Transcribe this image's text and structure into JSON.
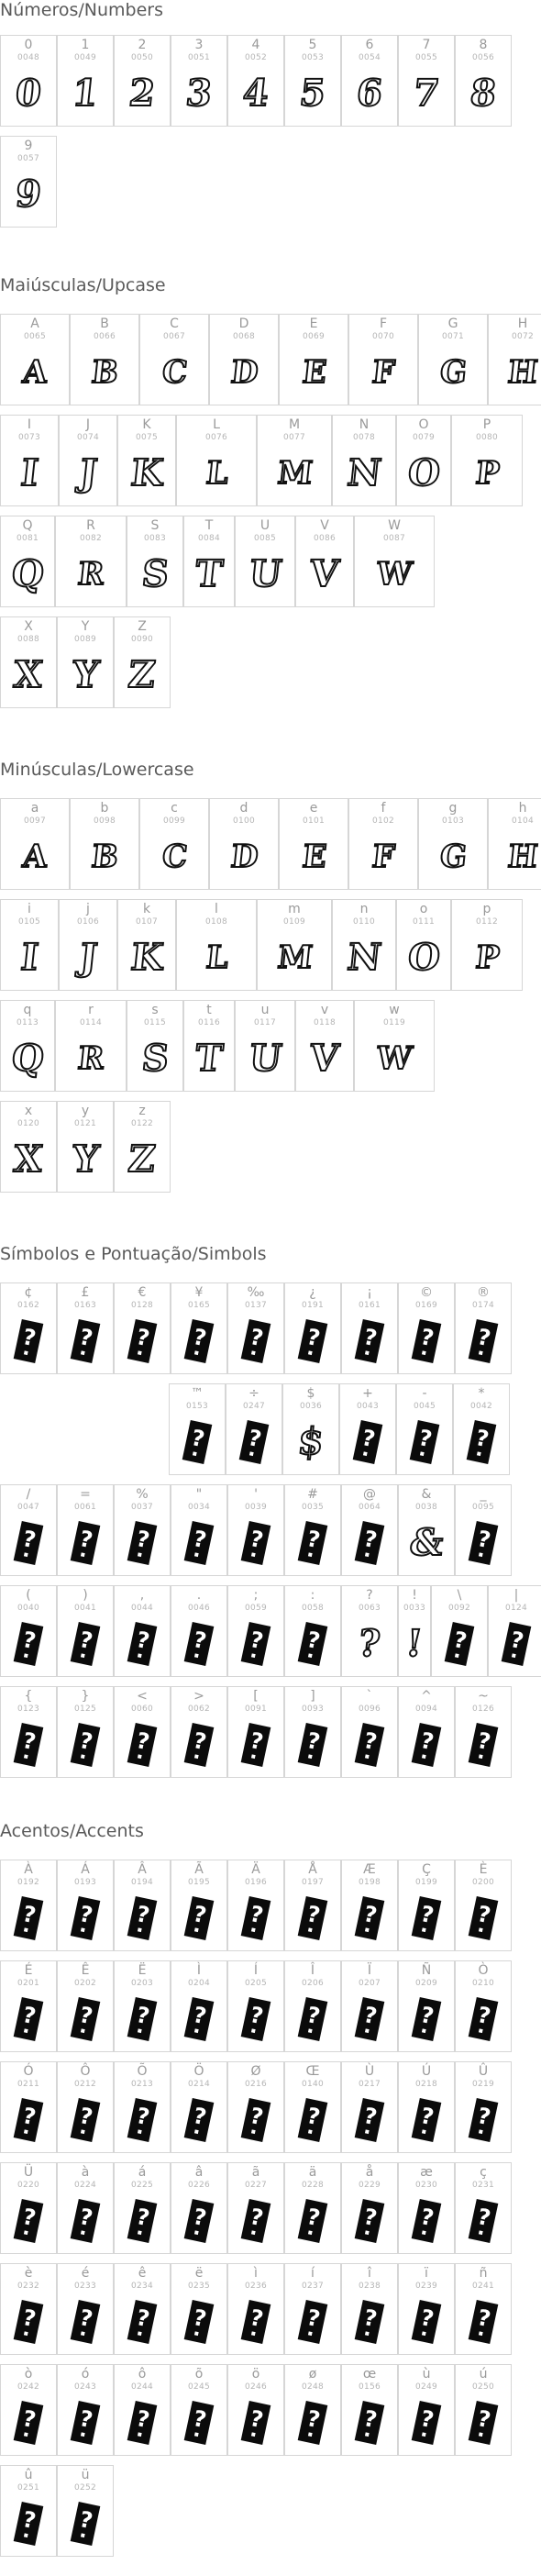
{
  "sections": [
    {
      "id": "numbers",
      "title": "Números/Numbers",
      "cells": [
        {
          "label": "0",
          "code": "0048",
          "glyph": "0"
        },
        {
          "label": "1",
          "code": "0049",
          "glyph": "1"
        },
        {
          "label": "2",
          "code": "0050",
          "glyph": "2"
        },
        {
          "label": "3",
          "code": "0051",
          "glyph": "3"
        },
        {
          "label": "4",
          "code": "0052",
          "glyph": "4"
        },
        {
          "label": "5",
          "code": "0053",
          "glyph": "5"
        },
        {
          "label": "6",
          "code": "0054",
          "glyph": "6"
        },
        {
          "label": "7",
          "code": "0055",
          "glyph": "7"
        },
        {
          "label": "8",
          "code": "0056",
          "glyph": "8"
        },
        {
          "label": "9",
          "code": "0057",
          "glyph": "9"
        }
      ]
    },
    {
      "id": "upper",
      "title": "Maiúsculas/Upcase",
      "cells": [
        {
          "label": "A",
          "code": "0065",
          "glyph": "A"
        },
        {
          "label": "B",
          "code": "0066",
          "glyph": "B"
        },
        {
          "label": "C",
          "code": "0067",
          "glyph": "C"
        },
        {
          "label": "D",
          "code": "0068",
          "glyph": "D"
        },
        {
          "label": "E",
          "code": "0069",
          "glyph": "E"
        },
        {
          "label": "F",
          "code": "0070",
          "glyph": "F"
        },
        {
          "label": "G",
          "code": "0071",
          "glyph": "G"
        },
        {
          "label": "H",
          "code": "0072",
          "glyph": "H"
        },
        {
          "label": "I",
          "code": "0073",
          "glyph": "I"
        },
        {
          "label": "J",
          "code": "0074",
          "glyph": "J"
        },
        {
          "label": "K",
          "code": "0075",
          "glyph": "K"
        },
        {
          "label": "L",
          "code": "0076",
          "glyph": "L"
        },
        {
          "label": "M",
          "code": "0077",
          "glyph": "M"
        },
        {
          "label": "N",
          "code": "0078",
          "glyph": "N"
        },
        {
          "label": "O",
          "code": "0079",
          "glyph": "O"
        },
        {
          "label": "P",
          "code": "0080",
          "glyph": "P"
        },
        {
          "label": "Q",
          "code": "0081",
          "glyph": "Q"
        },
        {
          "label": "R",
          "code": "0082",
          "glyph": "R"
        },
        {
          "label": "S",
          "code": "0083",
          "glyph": "S"
        },
        {
          "label": "T",
          "code": "0084",
          "glyph": "T"
        },
        {
          "label": "U",
          "code": "0085",
          "glyph": "U"
        },
        {
          "label": "V",
          "code": "0086",
          "glyph": "V"
        },
        {
          "label": "W",
          "code": "0087",
          "glyph": "W"
        },
        {
          "label": "X",
          "code": "0088",
          "glyph": "X"
        },
        {
          "label": "Y",
          "code": "0089",
          "glyph": "Y"
        },
        {
          "label": "Z",
          "code": "0090",
          "glyph": "Z"
        }
      ]
    },
    {
      "id": "lower",
      "title": "Minúsculas/Lowercase",
      "cells": [
        {
          "label": "a",
          "code": "0097",
          "glyph": "A"
        },
        {
          "label": "b",
          "code": "0098",
          "glyph": "B"
        },
        {
          "label": "c",
          "code": "0099",
          "glyph": "C"
        },
        {
          "label": "d",
          "code": "0100",
          "glyph": "D"
        },
        {
          "label": "e",
          "code": "0101",
          "glyph": "E"
        },
        {
          "label": "f",
          "code": "0102",
          "glyph": "F"
        },
        {
          "label": "g",
          "code": "0103",
          "glyph": "G"
        },
        {
          "label": "h",
          "code": "0104",
          "glyph": "H"
        },
        {
          "label": "i",
          "code": "0105",
          "glyph": "I"
        },
        {
          "label": "j",
          "code": "0106",
          "glyph": "J"
        },
        {
          "label": "k",
          "code": "0107",
          "glyph": "K"
        },
        {
          "label": "l",
          "code": "0108",
          "glyph": "L"
        },
        {
          "label": "m",
          "code": "0109",
          "glyph": "M"
        },
        {
          "label": "n",
          "code": "0110",
          "glyph": "N"
        },
        {
          "label": "o",
          "code": "0111",
          "glyph": "O"
        },
        {
          "label": "p",
          "code": "0112",
          "glyph": "P"
        },
        {
          "label": "q",
          "code": "0113",
          "glyph": "Q"
        },
        {
          "label": "r",
          "code": "0114",
          "glyph": "R"
        },
        {
          "label": "s",
          "code": "0115",
          "glyph": "S"
        },
        {
          "label": "t",
          "code": "0116",
          "glyph": "T"
        },
        {
          "label": "u",
          "code": "0117",
          "glyph": "U"
        },
        {
          "label": "v",
          "code": "0118",
          "glyph": "V"
        },
        {
          "label": "w",
          "code": "0119",
          "glyph": "W"
        },
        {
          "label": "x",
          "code": "0120",
          "glyph": "X"
        },
        {
          "label": "y",
          "code": "0121",
          "glyph": "Y"
        },
        {
          "label": "z",
          "code": "0122",
          "glyph": "Z"
        }
      ]
    },
    {
      "id": "symbols",
      "title": "Símbolos e Pontuação/Simbols",
      "cells": [
        {
          "label": "¢",
          "code": "0162",
          "glyph": ""
        },
        {
          "label": "£",
          "code": "0163",
          "glyph": ""
        },
        {
          "label": "€",
          "code": "0128",
          "glyph": ""
        },
        {
          "label": "¥",
          "code": "0165",
          "glyph": ""
        },
        {
          "label": "‰",
          "code": "0137",
          "glyph": ""
        },
        {
          "label": "¿",
          "code": "0191",
          "glyph": ""
        },
        {
          "label": "¡",
          "code": "0161",
          "glyph": ""
        },
        {
          "label": "©",
          "code": "0169",
          "glyph": ""
        },
        {
          "label": "®",
          "code": "0174",
          "glyph": ""
        },
        {
          "label": "™",
          "code": "0153",
          "glyph": ""
        },
        {
          "label": "÷",
          "code": "0247",
          "glyph": ""
        },
        {
          "label": "$",
          "code": "0036",
          "glyph": "$"
        },
        {
          "label": "+",
          "code": "0043",
          "glyph": ""
        },
        {
          "label": "-",
          "code": "0045",
          "glyph": ""
        },
        {
          "label": "*",
          "code": "0042",
          "glyph": ""
        },
        {
          "label": "/",
          "code": "0047",
          "glyph": ""
        },
        {
          "label": "=",
          "code": "0061",
          "glyph": ""
        },
        {
          "label": "%",
          "code": "0037",
          "glyph": ""
        },
        {
          "label": "\"",
          "code": "0034",
          "glyph": ""
        },
        {
          "label": "'",
          "code": "0039",
          "glyph": ""
        },
        {
          "label": "#",
          "code": "0035",
          "glyph": ""
        },
        {
          "label": "@",
          "code": "0064",
          "glyph": ""
        },
        {
          "label": "&",
          "code": "0038",
          "glyph": "&"
        },
        {
          "label": "_",
          "code": "0095",
          "glyph": ""
        },
        {
          "label": "(",
          "code": "0040",
          "glyph": ""
        },
        {
          "label": ")",
          "code": "0041",
          "glyph": ""
        },
        {
          "label": ",",
          "code": "0044",
          "glyph": ""
        },
        {
          "label": ".",
          "code": "0046",
          "glyph": ""
        },
        {
          "label": ";",
          "code": "0059",
          "glyph": ""
        },
        {
          "label": ":",
          "code": "0058",
          "glyph": ""
        },
        {
          "label": "?",
          "code": "0063",
          "glyph": "?"
        },
        {
          "label": "!",
          "code": "0033",
          "glyph": "!"
        },
        {
          "label": "\\",
          "code": "0092",
          "glyph": ""
        },
        {
          "label": "|",
          "code": "0124",
          "glyph": ""
        },
        {
          "label": "{",
          "code": "0123",
          "glyph": ""
        },
        {
          "label": "}",
          "code": "0125",
          "glyph": ""
        },
        {
          "label": "<",
          "code": "0060",
          "glyph": ""
        },
        {
          "label": ">",
          "code": "0062",
          "glyph": ""
        },
        {
          "label": "[",
          "code": "0091",
          "glyph": ""
        },
        {
          "label": "]",
          "code": "0093",
          "glyph": ""
        },
        {
          "label": "`",
          "code": "0096",
          "glyph": ""
        },
        {
          "label": "^",
          "code": "0094",
          "glyph": ""
        },
        {
          "label": "~",
          "code": "0126",
          "glyph": ""
        }
      ]
    },
    {
      "id": "accents",
      "title": "Acentos/Accents",
      "cells": [
        {
          "label": "À",
          "code": "0192",
          "glyph": ""
        },
        {
          "label": "Á",
          "code": "0193",
          "glyph": ""
        },
        {
          "label": "Â",
          "code": "0194",
          "glyph": ""
        },
        {
          "label": "Ã",
          "code": "0195",
          "glyph": ""
        },
        {
          "label": "Ä",
          "code": "0196",
          "glyph": ""
        },
        {
          "label": "Å",
          "code": "0197",
          "glyph": ""
        },
        {
          "label": "Æ",
          "code": "0198",
          "glyph": ""
        },
        {
          "label": "Ç",
          "code": "0199",
          "glyph": ""
        },
        {
          "label": "È",
          "code": "0200",
          "glyph": ""
        },
        {
          "label": "É",
          "code": "0201",
          "glyph": ""
        },
        {
          "label": "Ê",
          "code": "0202",
          "glyph": ""
        },
        {
          "label": "Ë",
          "code": "0203",
          "glyph": ""
        },
        {
          "label": "Ì",
          "code": "0204",
          "glyph": ""
        },
        {
          "label": "Í",
          "code": "0205",
          "glyph": ""
        },
        {
          "label": "Î",
          "code": "0206",
          "glyph": ""
        },
        {
          "label": "Ï",
          "code": "0207",
          "glyph": ""
        },
        {
          "label": "Ñ",
          "code": "0209",
          "glyph": ""
        },
        {
          "label": "Ò",
          "code": "0210",
          "glyph": ""
        },
        {
          "label": "Ó",
          "code": "0211",
          "glyph": ""
        },
        {
          "label": "Ô",
          "code": "0212",
          "glyph": ""
        },
        {
          "label": "Õ",
          "code": "0213",
          "glyph": ""
        },
        {
          "label": "Ö",
          "code": "0214",
          "glyph": ""
        },
        {
          "label": "Ø",
          "code": "0216",
          "glyph": ""
        },
        {
          "label": "Œ",
          "code": "0140",
          "glyph": ""
        },
        {
          "label": "Ù",
          "code": "0217",
          "glyph": ""
        },
        {
          "label": "Ú",
          "code": "0218",
          "glyph": ""
        },
        {
          "label": "Û",
          "code": "0219",
          "glyph": ""
        },
        {
          "label": "Ü",
          "code": "0220",
          "glyph": ""
        },
        {
          "label": "à",
          "code": "0224",
          "glyph": ""
        },
        {
          "label": "á",
          "code": "0225",
          "glyph": ""
        },
        {
          "label": "â",
          "code": "0226",
          "glyph": ""
        },
        {
          "label": "ã",
          "code": "0227",
          "glyph": ""
        },
        {
          "label": "ä",
          "code": "0228",
          "glyph": ""
        },
        {
          "label": "å",
          "code": "0229",
          "glyph": ""
        },
        {
          "label": "æ",
          "code": "0230",
          "glyph": ""
        },
        {
          "label": "ç",
          "code": "0231",
          "glyph": ""
        },
        {
          "label": "è",
          "code": "0232",
          "glyph": ""
        },
        {
          "label": "é",
          "code": "0233",
          "glyph": ""
        },
        {
          "label": "ê",
          "code": "0234",
          "glyph": ""
        },
        {
          "label": "ë",
          "code": "0235",
          "glyph": ""
        },
        {
          "label": "ì",
          "code": "0236",
          "glyph": ""
        },
        {
          "label": "í",
          "code": "0237",
          "glyph": ""
        },
        {
          "label": "î",
          "code": "0238",
          "glyph": ""
        },
        {
          "label": "ï",
          "code": "0239",
          "glyph": ""
        },
        {
          "label": "ñ",
          "code": "0241",
          "glyph": ""
        },
        {
          "label": "ò",
          "code": "0242",
          "glyph": ""
        },
        {
          "label": "ó",
          "code": "0243",
          "glyph": ""
        },
        {
          "label": "ô",
          "code": "0244",
          "glyph": ""
        },
        {
          "label": "õ",
          "code": "0245",
          "glyph": ""
        },
        {
          "label": "ö",
          "code": "0246",
          "glyph": ""
        },
        {
          "label": "ø",
          "code": "0248",
          "glyph": ""
        },
        {
          "label": "œ",
          "code": "0156",
          "glyph": ""
        },
        {
          "label": "ù",
          "code": "0249",
          "glyph": ""
        },
        {
          "label": "ú",
          "code": "0250",
          "glyph": ""
        },
        {
          "label": "û",
          "code": "0251",
          "glyph": ""
        },
        {
          "label": "ü",
          "code": "0252",
          "glyph": ""
        }
      ]
    }
  ]
}
